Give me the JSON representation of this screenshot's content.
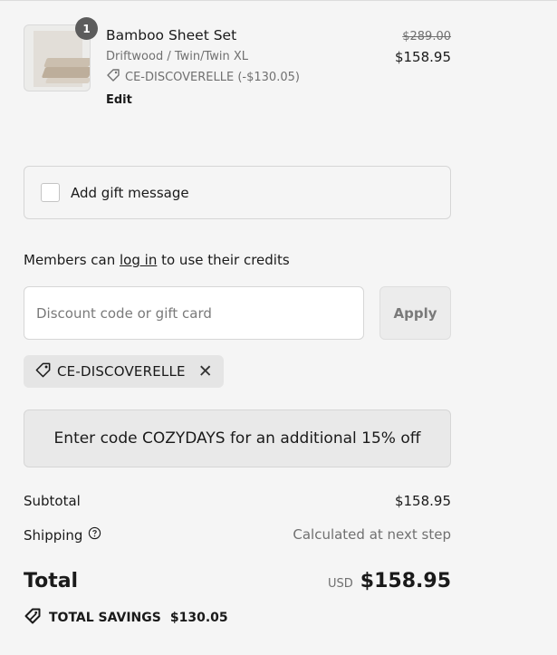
{
  "product": {
    "quantity": "1",
    "name": "Bamboo Sheet Set",
    "variant": "Driftwood / Twin/Twin XL",
    "discount": "CE-DISCOVERELLE (-$130.05)",
    "edit_label": "Edit",
    "price_original": "$289.00",
    "price_current": "$158.95"
  },
  "gift": {
    "label": "Add gift message",
    "checked": false
  },
  "members": {
    "prefix": "Members can",
    "link": "log in",
    "suffix": "to use their credits"
  },
  "discount": {
    "placeholder": "Discount code or gift card",
    "value": "",
    "apply_label": "Apply",
    "applied_code": "CE-DISCOVERELLE"
  },
  "promo": {
    "text": "Enter code COZYDAYS for an additional 15% off"
  },
  "summary": {
    "subtotal_label": "Subtotal",
    "subtotal_value": "$158.95",
    "shipping_label": "Shipping",
    "shipping_value": "Calculated at next step",
    "total_label": "Total",
    "currency": "USD",
    "total_value": "$158.95",
    "savings_label": "TOTAL SAVINGS",
    "savings_value": "$130.05"
  },
  "colors": {
    "background": "#f5f5f5",
    "text": "#1a1a1a",
    "muted": "#707070",
    "badge": "#5c5c5c"
  },
  "icons": [
    "tag-icon",
    "close-icon",
    "help-circle-icon",
    "savings-tag-icon"
  ]
}
